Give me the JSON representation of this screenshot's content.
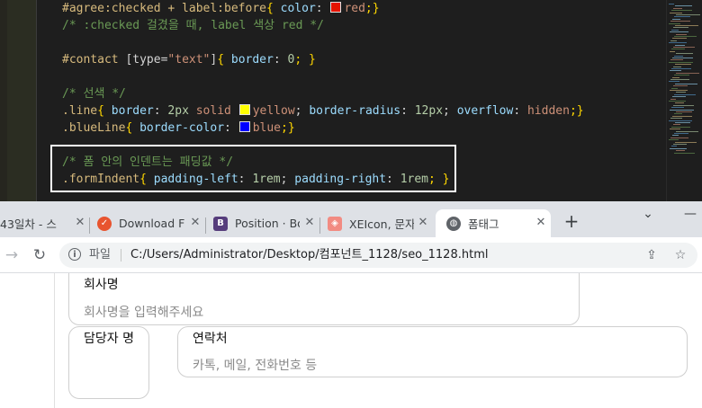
{
  "editor": {
    "lines": [
      [
        {
          "t": "#agree:checked + label:before",
          "c": "sel"
        },
        {
          "t": "{ ",
          "c": "brace"
        },
        {
          "t": "color",
          "c": "prop"
        },
        {
          "t": ": ",
          "c": "punct"
        },
        {
          "sw": "#e51400"
        },
        {
          "t": "red",
          "c": "val"
        },
        {
          "t": ";}",
          "c": "brace"
        }
      ],
      [
        {
          "t": "/* :checked 걸겼을 때, label 색상 red */",
          "c": "cmt"
        }
      ],
      [],
      [
        {
          "t": "#contact ",
          "c": "sel"
        },
        {
          "t": "[type=",
          "c": "punct"
        },
        {
          "t": "\"text\"",
          "c": "val"
        },
        {
          "t": "]",
          "c": "punct"
        },
        {
          "t": "{ ",
          "c": "brace"
        },
        {
          "t": "border",
          "c": "prop"
        },
        {
          "t": ": ",
          "c": "punct"
        },
        {
          "t": "0",
          "c": "num"
        },
        {
          "t": "; }",
          "c": "brace"
        }
      ],
      [],
      [
        {
          "t": "/* 선색 */",
          "c": "cmt"
        }
      ],
      [
        {
          "t": ".line",
          "c": "sel"
        },
        {
          "t": "{ ",
          "c": "brace"
        },
        {
          "t": "border",
          "c": "prop"
        },
        {
          "t": ": ",
          "c": "punct"
        },
        {
          "t": "2px",
          "c": "num"
        },
        {
          "t": " solid ",
          "c": "val"
        },
        {
          "sw": "#ffff00"
        },
        {
          "t": "yellow",
          "c": "val"
        },
        {
          "t": "; ",
          "c": "punct"
        },
        {
          "t": "border-radius",
          "c": "prop"
        },
        {
          "t": ": ",
          "c": "punct"
        },
        {
          "t": "12px",
          "c": "num"
        },
        {
          "t": "; ",
          "c": "punct"
        },
        {
          "t": "overflow",
          "c": "prop"
        },
        {
          "t": ": ",
          "c": "punct"
        },
        {
          "t": "hidden",
          "c": "val"
        },
        {
          "t": ";}",
          "c": "brace"
        }
      ],
      [
        {
          "t": ".blueLine",
          "c": "sel"
        },
        {
          "t": "{ ",
          "c": "brace"
        },
        {
          "t": "border-color",
          "c": "prop"
        },
        {
          "t": ": ",
          "c": "punct"
        },
        {
          "sw": "#0000ff"
        },
        {
          "t": "blue",
          "c": "val"
        },
        {
          "t": ";}",
          "c": "brace"
        }
      ],
      [],
      [
        {
          "t": "/* 폼 안의 인덴트는 패딩값 */",
          "c": "cmt"
        }
      ],
      [
        {
          "t": ".formIndent",
          "c": "sel"
        },
        {
          "t": "{ ",
          "c": "brace"
        },
        {
          "t": "padding-left",
          "c": "prop"
        },
        {
          "t": ": ",
          "c": "punct"
        },
        {
          "t": "1rem",
          "c": "num"
        },
        {
          "t": "; ",
          "c": "punct"
        },
        {
          "t": "padding-right",
          "c": "prop"
        },
        {
          "t": ": ",
          "c": "punct"
        },
        {
          "t": "1rem",
          "c": "num"
        },
        {
          "t": "; }",
          "c": "brace"
        }
      ]
    ]
  },
  "tabs": [
    {
      "title": "43일차 - 스",
      "icon": "document-icon",
      "color": "#5f6368",
      "glyph": ""
    },
    {
      "title": "Download F",
      "icon": "download-app-icon",
      "color": "#e8542f",
      "glyph": "✓"
    },
    {
      "title": "Position · Bo",
      "icon": "bootstrap-icon",
      "color": "#563d7c",
      "glyph": "B"
    },
    {
      "title": "XEIcon, 문자",
      "icon": "xeicon-icon",
      "color": "#f28b82",
      "glyph": "◈"
    },
    {
      "title": "폼태그",
      "icon": "globe-icon",
      "color": "#5f6368",
      "glyph": "◍",
      "active": true
    }
  ],
  "window": {
    "minimize": "⌄",
    "restore": "—"
  },
  "toolbar": {
    "scheme": "파일",
    "url": "C:/Users/Administrator/Desktop/컴포넌트_1128/seo_1128.html"
  },
  "form": {
    "company": {
      "label": "회사명",
      "placeholder": "회사명을 입력해주세요"
    },
    "manager": {
      "label": "담당자 명"
    },
    "contact": {
      "label": "연락처",
      "placeholder": "카톡, 메일, 전화번호 등"
    }
  }
}
